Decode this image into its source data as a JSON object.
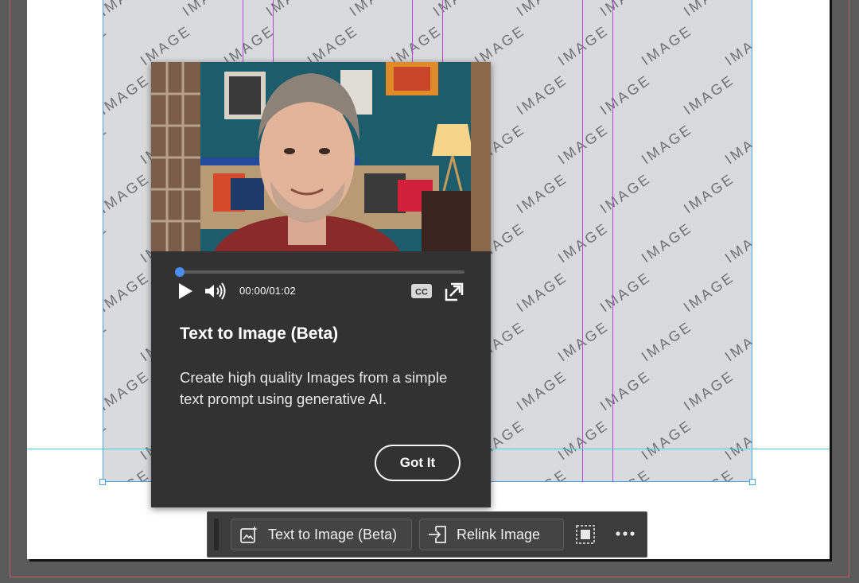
{
  "canvas": {
    "placeholder_text": "IMAGE",
    "colors": {
      "frame_fill": "#d9dadd",
      "guide_purple": "#b24ad6",
      "guide_cyan": "#40d5d8",
      "frame_border": "#4aa3df"
    }
  },
  "popover": {
    "video": {
      "time_display": "00:00/01:02",
      "progress": 0,
      "cc_label": "CC",
      "icons": [
        "play-icon",
        "volume-icon",
        "closed-captions-icon",
        "fullscreen-icon"
      ]
    },
    "title": "Text to Image (Beta)",
    "description": "Create high quality Images from a simple text prompt using generative AI.",
    "button_label": "Got It",
    "accent_color": "#4b8ef0"
  },
  "taskbar": {
    "text_to_image_label": "Text to Image (Beta)",
    "relink_label": "Relink Image",
    "icons": [
      "generative-image-icon",
      "relink-icon",
      "frame-fit-icon",
      "more-icon"
    ]
  }
}
